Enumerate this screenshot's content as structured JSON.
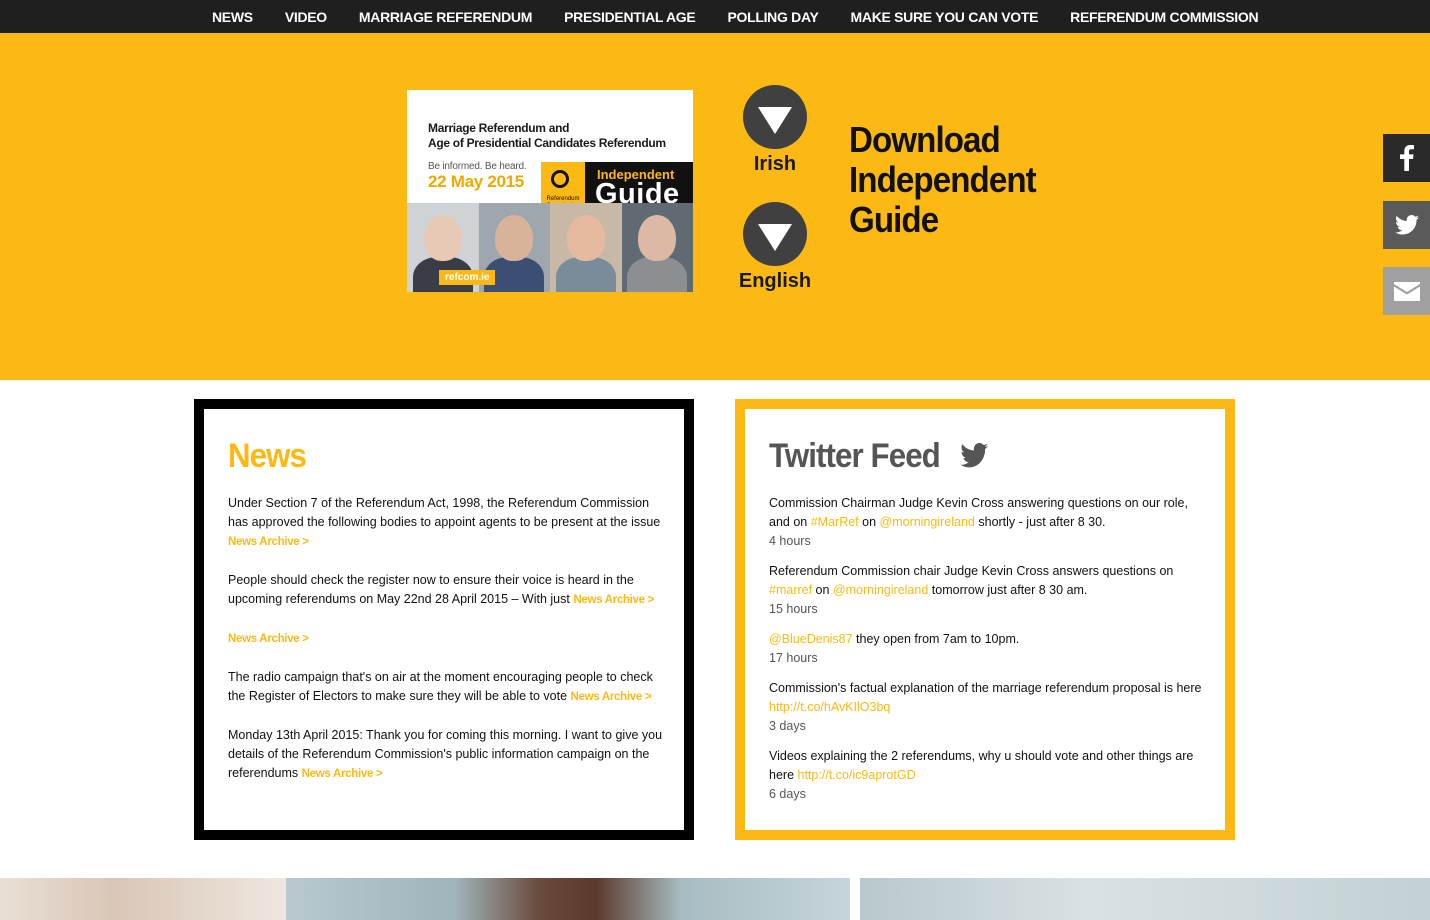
{
  "nav": {
    "items": [
      "NEWS",
      "VIDEO",
      "MARRIAGE REFERENDUM",
      "PRESIDENTIAL AGE",
      "POLLING DAY",
      "MAKE SURE YOU CAN VOTE",
      "REFERENDUM COMMISSION"
    ]
  },
  "hero": {
    "cover": {
      "line1": "Marriage Referendum and",
      "line2": "Age of Presidential Candidates Referendum",
      "tagline": "Be informed. Be heard.",
      "date": "22 May 2015",
      "logo_text": "Referendum Commission",
      "badge_top": "Independent",
      "badge_bottom": "Guide",
      "site": "refcom.ie"
    },
    "download_irish": "Irish",
    "download_english": "English",
    "download_title_1": "Download",
    "download_title_2": "Independent",
    "download_title_3": "Guide"
  },
  "social": {
    "facebook": "facebook-icon",
    "twitter": "twitter-icon",
    "email": "email-icon"
  },
  "news": {
    "title": "News",
    "archive_label": "News Archive >",
    "items": [
      {
        "text": "Under Section 7 of the Referendum Act, 1998, the Referendum Commission has approved the following bodies to appoint agents to be present at the issue"
      },
      {
        "text": "People should check the register now to ensure their voice is heard in the upcoming referendums on May 22nd 28 April 2015 – With just"
      },
      {
        "text": ""
      },
      {
        "text": "The radio campaign that's on air at the moment encouraging people to check the Register of Electors to make sure they will be able to vote"
      },
      {
        "text": "Monday 13th April 2015:  Thank you for coming this morning. I want to give you details of the Referendum Commission's public information campaign on the referendums"
      }
    ]
  },
  "twitter": {
    "title": "Twitter Feed",
    "tweets": [
      {
        "t1": "Commission Chairman Judge Kevin Cross answering questions on our role, and on ",
        "l1": "#MarRef",
        "t2": " on ",
        "l2": "@morningireland",
        "t3": " shortly - just after 8 30.",
        "time": "4 hours"
      },
      {
        "t1": "Referendum Commission chair Judge Kevin Cross answers questions on ",
        "l1": "#marref",
        "t2": " on ",
        "l2": "@morningireland",
        "t3": " tomorrow just after 8 30 am.",
        "time": "15 hours"
      },
      {
        "t1": "",
        "l1": "@BlueDenis87",
        "t2": " they open from 7am to 10pm.",
        "l2": "",
        "t3": "",
        "time": "17 hours"
      },
      {
        "t1": "Commission's factual explanation of the marriage referendum proposal is here ",
        "l1": "http://t.co/hAvKIlO3bq",
        "t2": "",
        "l2": "",
        "t3": "",
        "time": "3 days"
      },
      {
        "t1": "Videos explaining the 2 referendums, why u should vote and other things are here ",
        "l1": "http://t.co/ic9aprotGD",
        "t2": "",
        "l2": "",
        "t3": "",
        "time": "6 days"
      }
    ]
  },
  "colors": {
    "accent": "#fdb913",
    "nav_bg": "#1f1f1f",
    "dark_circle": "#404040"
  }
}
